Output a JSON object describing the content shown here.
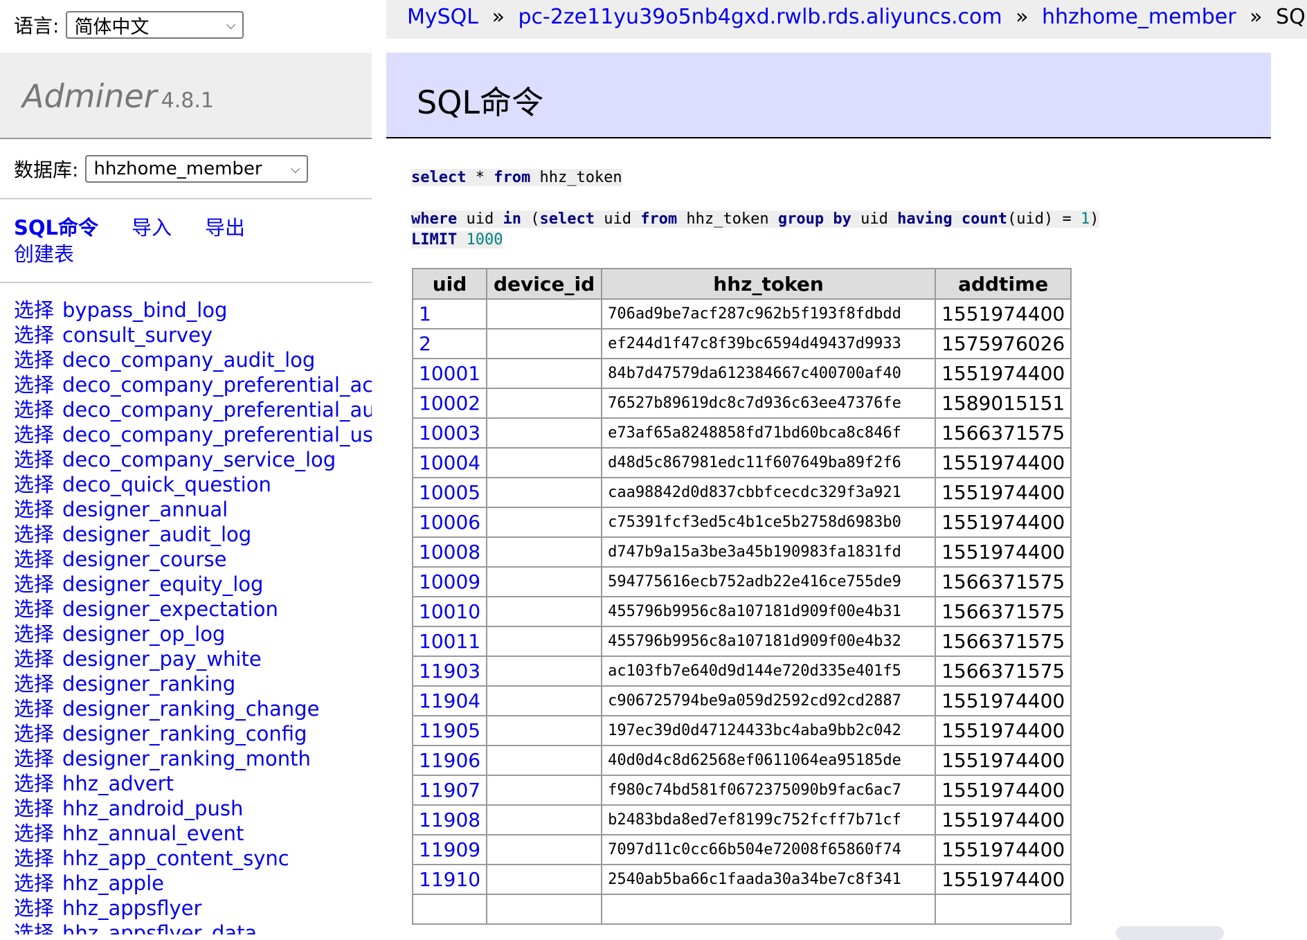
{
  "lang": {
    "label": "语言:",
    "selected": "简体中文"
  },
  "logo": {
    "name": "Adminer",
    "version": "4.8.1"
  },
  "db": {
    "label": "数据库:",
    "selected": "hhzhome_member"
  },
  "links": {
    "sql": "SQL命令",
    "import": "导入",
    "export": "导出",
    "create": "创建表"
  },
  "select_label": "选择",
  "tables": [
    "bypass_bind_log",
    "consult_survey",
    "deco_company_audit_log",
    "deco_company_preferential_ac",
    "deco_company_preferential_au",
    "deco_company_preferential_us",
    "deco_company_service_log",
    "deco_quick_question",
    "designer_annual",
    "designer_audit_log",
    "designer_course",
    "designer_equity_log",
    "designer_expectation",
    "designer_op_log",
    "designer_pay_white",
    "designer_ranking",
    "designer_ranking_change",
    "designer_ranking_config",
    "designer_ranking_month",
    "hhz_advert",
    "hhz_android_push",
    "hhz_annual_event",
    "hhz_app_content_sync",
    "hhz_apple",
    "hhz_appsflyer",
    "hhz_appsflyer_data"
  ],
  "breadcrumb": {
    "driver": "MySQL",
    "server": "pc-2ze11yu39o5nb4gxd.rwlb.rds.aliyuncs.com",
    "database": "hhzhome_member",
    "current": "SQL命令",
    "separator": "»"
  },
  "page_title": "SQL命令",
  "query": {
    "line1": {
      "k1": "select",
      "t1": " * ",
      "k2": "from",
      "t2": " hhz_token"
    },
    "line2": {
      "k1": "where",
      "t1": " uid ",
      "k2": "in",
      "t2": " (",
      "k3": "select",
      "t3": " uid ",
      "k4": "from",
      "t4": " hhz_token ",
      "k5": "group",
      "t5": " ",
      "k6": "by",
      "t6": " uid ",
      "k7": "having",
      "t7": " ",
      "k8": "count",
      "t8": "(uid) = ",
      "n1": "1",
      "t9": ")"
    },
    "line3": {
      "k1": "LIMIT",
      "t1": " ",
      "n1": "1000"
    }
  },
  "result": {
    "columns": [
      "uid",
      "device_id",
      "hhz_token",
      "addtime"
    ],
    "rows": [
      [
        "1",
        "",
        "706ad9be7acf287c962b5f193f8fdbdd",
        "1551974400"
      ],
      [
        "2",
        "",
        "ef244d1f47c8f39bc6594d49437d9933",
        "1575976026"
      ],
      [
        "10001",
        "",
        "84b7d47579da612384667c400700af40",
        "1551974400"
      ],
      [
        "10002",
        "",
        "76527b89619dc8c7d936c63ee47376fe",
        "1589015151"
      ],
      [
        "10003",
        "",
        "e73af65a8248858fd71bd60bca8c846f",
        "1566371575"
      ],
      [
        "10004",
        "",
        "d48d5c867981edc11f607649ba89f2f6",
        "1551974400"
      ],
      [
        "10005",
        "",
        "caa98842d0d837cbbfcecdc329f3a921",
        "1551974400"
      ],
      [
        "10006",
        "",
        "c75391fcf3ed5c4b1ce5b2758d6983b0",
        "1551974400"
      ],
      [
        "10008",
        "",
        "d747b9a15a3be3a45b190983fa1831fd",
        "1551974400"
      ],
      [
        "10009",
        "",
        "594775616ecb752adb22e416ce755de9",
        "1566371575"
      ],
      [
        "10010",
        "",
        "455796b9956c8a107181d909f00e4b31",
        "1566371575"
      ],
      [
        "10011",
        "",
        "455796b9956c8a107181d909f00e4b32",
        "1566371575"
      ],
      [
        "11903",
        "",
        "ac103fb7e640d9d144e720d335e401f5",
        "1566371575"
      ],
      [
        "11904",
        "",
        "c906725794be9a059d2592cd92cd2887",
        "1551974400"
      ],
      [
        "11905",
        "",
        "197ec39d0d47124433bc4aba9bb2c042",
        "1551974400"
      ],
      [
        "11906",
        "",
        "40d0d4c8d62568ef0611064ea95185de",
        "1551974400"
      ],
      [
        "11907",
        "",
        "f980c74bd581f0672375090b9fac6ac7",
        "1551974400"
      ],
      [
        "11908",
        "",
        "b2483bda8ed7ef8199c752fcff7b71cf",
        "1551974400"
      ],
      [
        "11909",
        "",
        "7097d11c0cc66b504e72008f65860f74",
        "1551974400"
      ],
      [
        "11910",
        "",
        "2540ab5ba66c1faada30a34be7c8f341",
        "1551974400"
      ],
      [
        "",
        "",
        "",
        ""
      ]
    ]
  }
}
